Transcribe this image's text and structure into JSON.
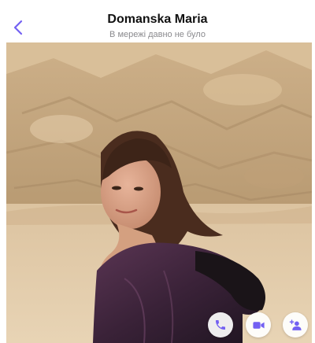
{
  "header": {
    "title": "Domanska Maria",
    "subtitle": "В мережі давно не було"
  },
  "icons": {
    "back": "chevron-left-icon",
    "call": "phone-icon",
    "video": "video-camera-icon",
    "add_participant": "add-participant-icon"
  },
  "colors": {
    "accent": "#7360f2",
    "title": "#111111",
    "subtitle": "#8a8a8e"
  }
}
